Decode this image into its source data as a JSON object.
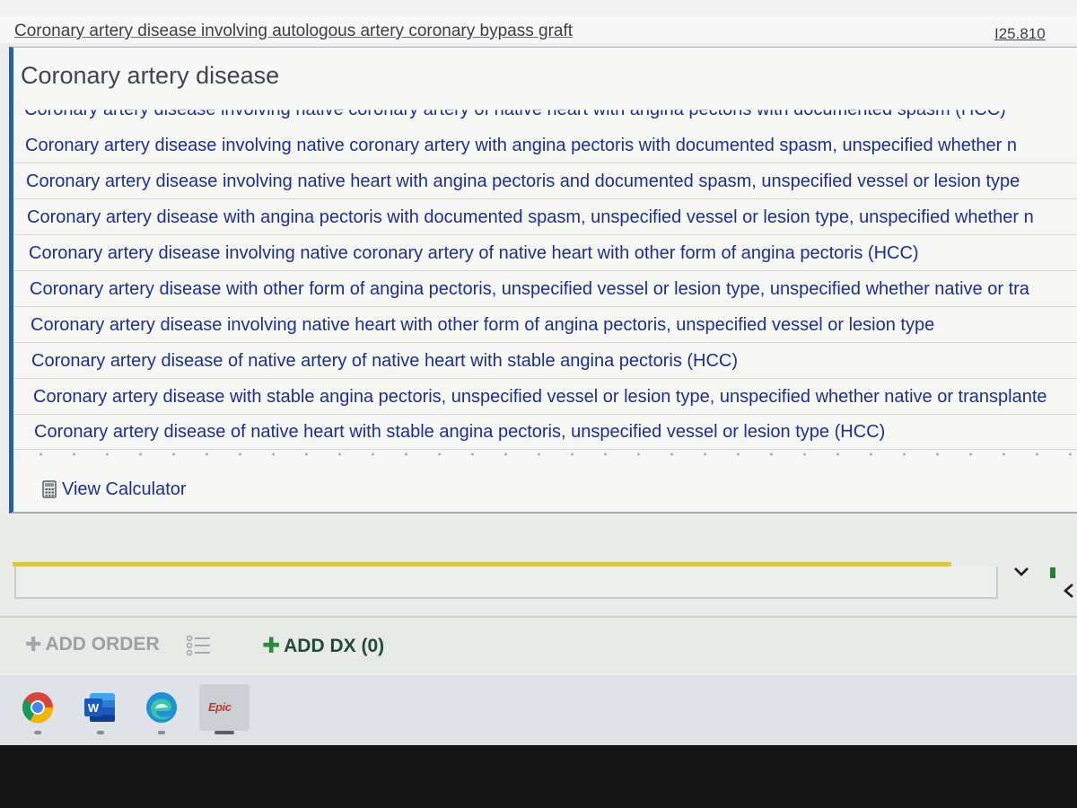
{
  "header": {
    "behind_row_text": "Coronary artery disease involving autologous artery coronary bypass graft",
    "behind_row_code": "I25.810"
  },
  "dropdown": {
    "title": "Coronary artery disease",
    "cut_off_row": "Coronary artery disease involving native coronary artery of native heart with angina pectoris with documented spasm (HCC)",
    "items": [
      "Coronary artery disease involving native coronary artery with angina pectoris with documented spasm, unspecified whether n",
      "Coronary artery disease involving native heart with angina pectoris and documented spasm, unspecified vessel or lesion type",
      "Coronary artery disease with angina pectoris with documented spasm, unspecified vessel or lesion type, unspecified whether n",
      "Coronary artery disease involving native coronary artery of native heart with other form of angina pectoris (HCC)",
      "Coronary artery disease with other form of angina pectoris, unspecified vessel or lesion type, unspecified whether native or tra",
      "Coronary artery disease involving native heart with other form of angina pectoris, unspecified vessel or lesion type",
      "Coronary artery disease of native artery of native heart with stable angina pectoris (HCC)",
      "Coronary artery disease with stable angina pectoris, unspecified vessel or lesion type, unspecified whether native or transplante",
      "Coronary artery disease of native heart with stable angina pectoris, unspecified vessel or lesion type (HCC)"
    ],
    "view_calculator": "View Calculator"
  },
  "order_bar": {
    "add_order": "ADD ORDER",
    "add_dx": "ADD DX (0)"
  },
  "taskbar": {
    "apps": [
      "chrome-icon",
      "word-icon",
      "edge-icon",
      "epic-icon"
    ],
    "word_letter": "W",
    "epic_label": "Epic"
  },
  "colors": {
    "link_blue": "#1d2f8e",
    "accent_blue": "#2c5fa0",
    "add_dx_green": "#2f8a3a",
    "highlight_yellow": "#e2c34a",
    "epic_red": "#c0392b"
  }
}
